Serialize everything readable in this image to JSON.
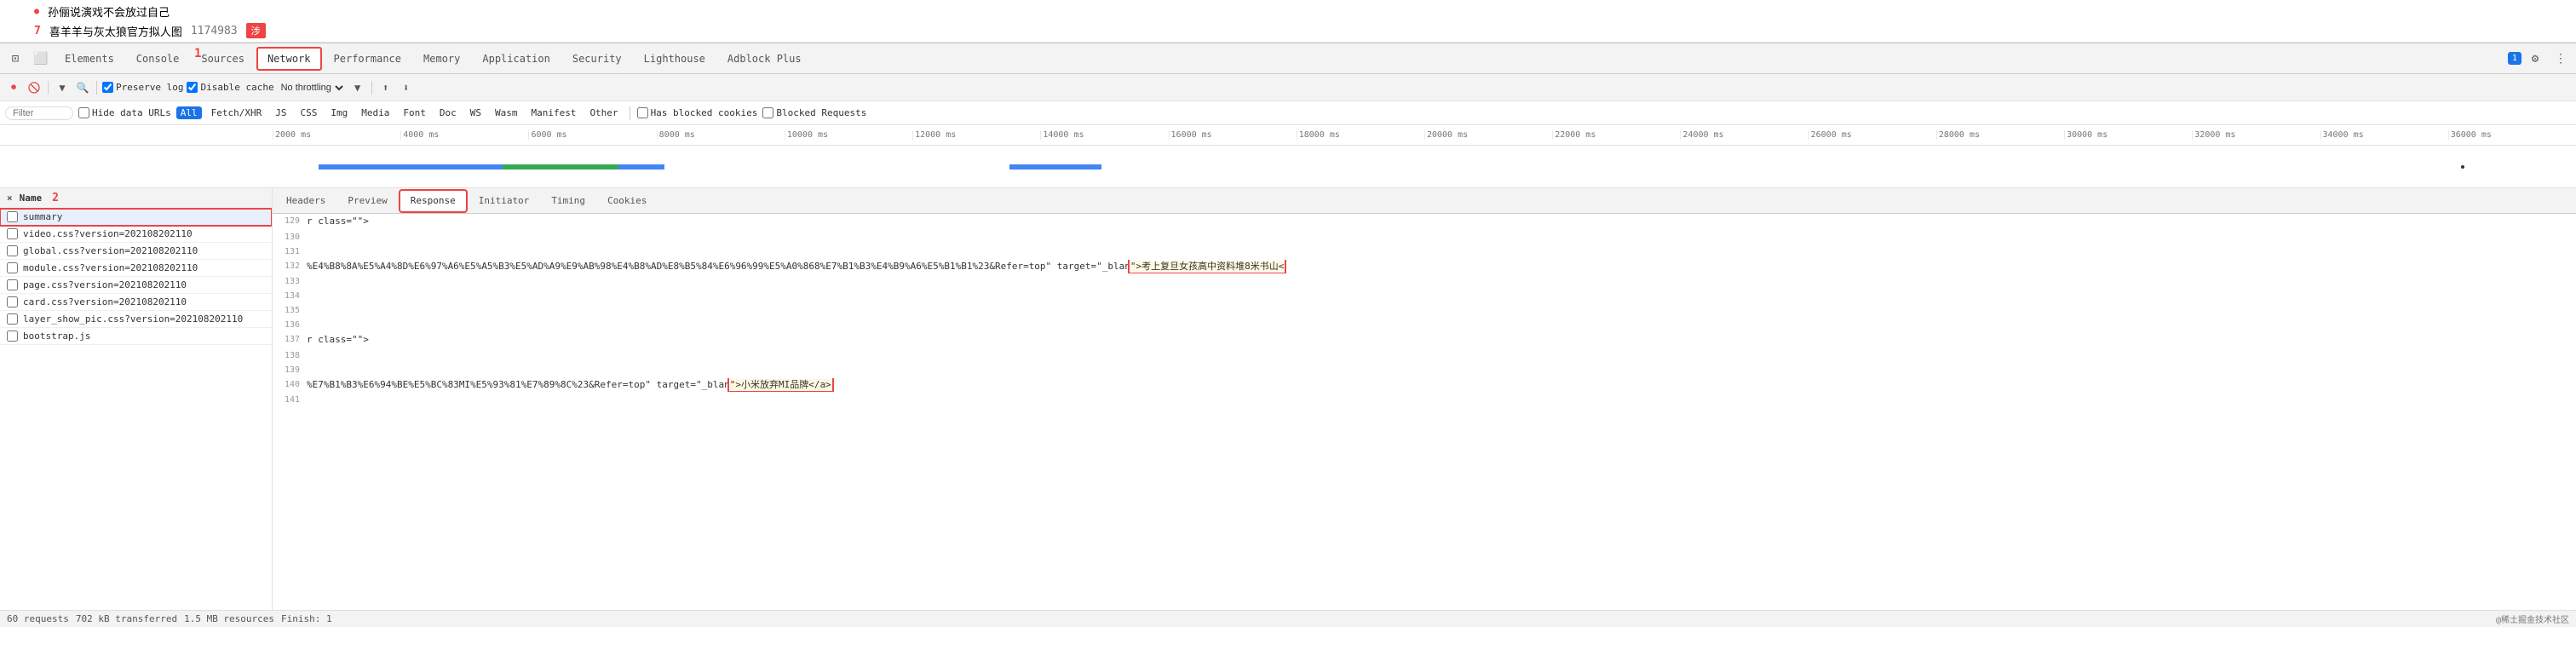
{
  "page": {
    "content_items": [
      {
        "type": "bullet",
        "text": "孙俪说演戏不会放过自己"
      },
      {
        "type": "numbered",
        "number": "7",
        "text": "喜羊羊与灰太狼官方拟人图",
        "id": "1174983",
        "hot": true
      }
    ]
  },
  "devtools": {
    "tabs": [
      {
        "label": "Elements",
        "active": false
      },
      {
        "label": "Console",
        "active": false
      },
      {
        "label": "Sources",
        "active": false
      },
      {
        "label": "Network",
        "active": true
      },
      {
        "label": "Performance",
        "active": false
      },
      {
        "label": "Memory",
        "active": false
      },
      {
        "label": "Application",
        "active": false
      },
      {
        "label": "Security",
        "active": false
      },
      {
        "label": "Lighthouse",
        "active": false
      },
      {
        "label": "Adblock Plus",
        "active": false
      }
    ],
    "right_badge": "1",
    "toolbar": {
      "preserve_log_label": "Preserve log",
      "disable_cache_label": "Disable cache",
      "throttle_label": "No throttling"
    },
    "filter": {
      "placeholder": "Filter",
      "hide_data_urls_label": "Hide data URLs",
      "types": [
        "All",
        "Fetch/XHR",
        "JS",
        "CSS",
        "Img",
        "Media",
        "Font",
        "Doc",
        "WS",
        "Wasm",
        "Manifest",
        "Other"
      ],
      "active_type": "All",
      "has_blocked_cookies_label": "Has blocked cookies",
      "blocked_requests_label": "Blocked Requests"
    },
    "timeline": {
      "labels": [
        "2000 ms",
        "4000 ms",
        "6000 ms",
        "8000 ms",
        "10000 ms",
        "12000 ms",
        "14000 ms",
        "16000 ms",
        "18000 ms",
        "20000 ms",
        "22000 ms",
        "24000 ms",
        "26000 ms",
        "28000 ms",
        "30000 ms",
        "32000 ms",
        "34000 ms",
        "36000 ms"
      ]
    },
    "file_list": {
      "header": "Name",
      "close_label": "×",
      "items": [
        {
          "name": "summary",
          "selected": true
        },
        {
          "name": "video.css?version=202108202110"
        },
        {
          "name": "global.css?version=202108202110"
        },
        {
          "name": "module.css?version=202108202110"
        },
        {
          "name": "page.css?version=202108202110"
        },
        {
          "name": "card.css?version=202108202110"
        },
        {
          "name": "layer_show_pic.css?version=202108202110"
        },
        {
          "name": "bootstrap.js"
        }
      ]
    },
    "response_tabs": [
      {
        "label": "Headers",
        "active": false
      },
      {
        "label": "Preview",
        "active": false
      },
      {
        "label": "Response",
        "active": true
      },
      {
        "label": "Initiator",
        "active": false
      },
      {
        "label": "Timing",
        "active": false
      },
      {
        "label": "Cookies",
        "active": false
      }
    ],
    "response_lines": [
      {
        "num": "129",
        "content": "r class=\"\">"
      },
      {
        "num": "130",
        "content": ""
      },
      {
        "num": "131",
        "content": ""
      },
      {
        "num": "132",
        "content": "%E4%B8%8A%E5%A4%8D%E6%97%A6%E5%A5%B3%E5%AD%A9%E9%AB%98%E4%B8%AD%E8%B5%84%E6%96%99%E5%A0%868%E7%B1%B3%E4%B9%A6%E5%B1%B1%23&Refer=top\" target=\"_blan"
      },
      {
        "num": "133",
        "content": ""
      },
      {
        "num": "134",
        "content": ""
      },
      {
        "num": "135",
        "content": ""
      },
      {
        "num": "136",
        "content": ""
      },
      {
        "num": "137",
        "content": "r class=\"\">"
      },
      {
        "num": "138",
        "content": ""
      },
      {
        "num": "139",
        "content": ""
      },
      {
        "num": "140",
        "content": "%E7%B1%B3%E6%94%BE%E5%BC%83MI%E5%93%81%E7%89%8C%23&Refer=top\" target=\"_blan"
      },
      {
        "num": "141",
        "content": ""
      }
    ],
    "response_suffix_132": "\">考上复旦女孩高中资料堆8米书山<",
    "response_suffix_140": "\">小米放弃MI品牌</a>",
    "status_bar": {
      "requests": "60 requests",
      "transferred": "702 kB transferred",
      "resources": "1.5 MB resources",
      "finish": "Finish: 1"
    },
    "annotations": {
      "label1": "1",
      "label2": "2"
    }
  }
}
